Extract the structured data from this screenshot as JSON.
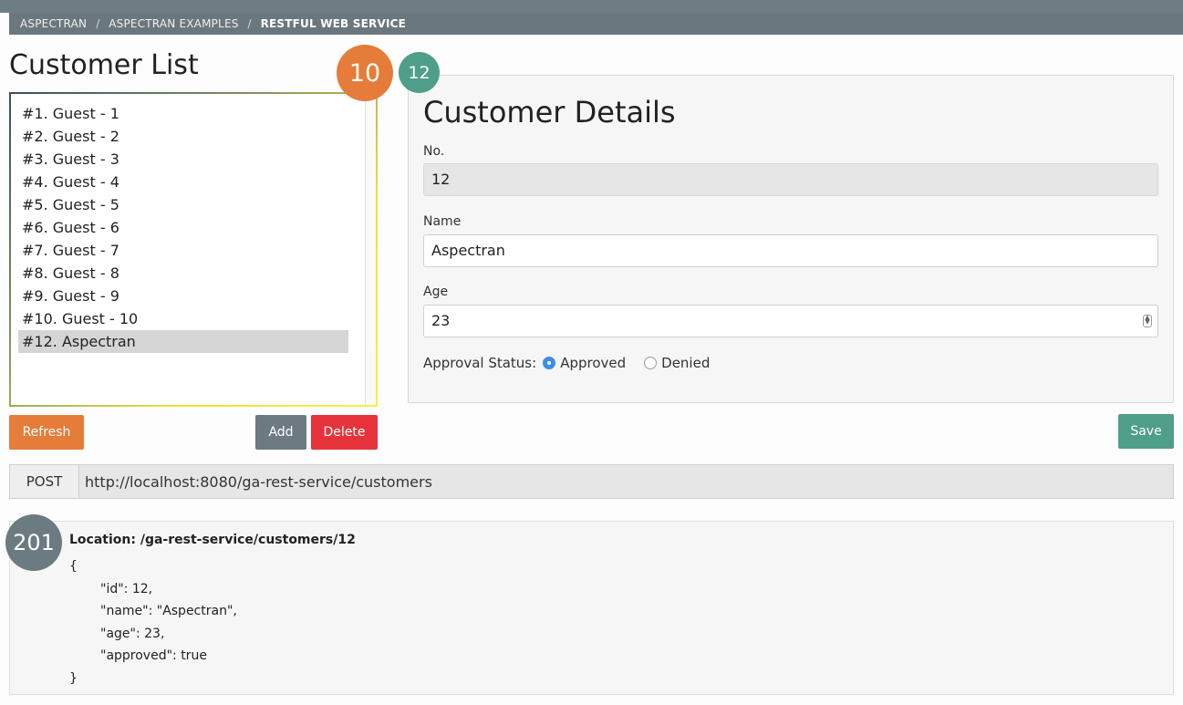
{
  "breadcrumb": {
    "items": [
      "ASPECTRAN",
      "ASPECTRAN EXAMPLES",
      "RESTFUL WEB SERVICE"
    ],
    "separator": "/"
  },
  "customer_list": {
    "title": "Customer List",
    "items": [
      {
        "label": "#1. Guest - 1",
        "selected": false
      },
      {
        "label": "#2. Guest - 2",
        "selected": false
      },
      {
        "label": "#3. Guest - 3",
        "selected": false
      },
      {
        "label": "#4. Guest - 4",
        "selected": false
      },
      {
        "label": "#5. Guest - 5",
        "selected": false
      },
      {
        "label": "#6. Guest - 6",
        "selected": false
      },
      {
        "label": "#7. Guest - 7",
        "selected": false
      },
      {
        "label": "#8. Guest - 8",
        "selected": false
      },
      {
        "label": "#9. Guest - 9",
        "selected": false
      },
      {
        "label": "#10. Guest - 10",
        "selected": false
      },
      {
        "label": "#12. Aspectran",
        "selected": true
      }
    ],
    "buttons": {
      "refresh": "Refresh",
      "add": "Add",
      "delete": "Delete"
    }
  },
  "badges": {
    "list_count": "10",
    "selected_id": "12",
    "status_code": "201"
  },
  "customer_details": {
    "title": "Customer Details",
    "no_label": "No.",
    "no_value": "12",
    "name_label": "Name",
    "name_value": "Aspectran",
    "age_label": "Age",
    "age_value": "23",
    "approval_label": "Approval Status:",
    "approval_options": [
      {
        "label": "Approved",
        "checked": true
      },
      {
        "label": "Denied",
        "checked": false
      }
    ],
    "save_label": "Save"
  },
  "request": {
    "method": "POST",
    "url": "http://localhost:8080/ga-rest-service/customers"
  },
  "response": {
    "location": "Location: /ga-rest-service/customers/12",
    "body_lines": [
      {
        "text": "{",
        "indent": false
      },
      {
        "text": "\"id\": 12,",
        "indent": true
      },
      {
        "text": "\"name\": \"Aspectran\",",
        "indent": true
      },
      {
        "text": "\"age\": 23,",
        "indent": true
      },
      {
        "text": "\"approved\": true",
        "indent": true
      },
      {
        "text": "}",
        "indent": false
      }
    ]
  },
  "colors": {
    "accent_orange": "#e57c3a",
    "accent_teal": "#4f9e8a",
    "danger_red": "#e6333b",
    "neutral_gray": "#6e7a82",
    "radio_blue": "#3b8ef0"
  }
}
